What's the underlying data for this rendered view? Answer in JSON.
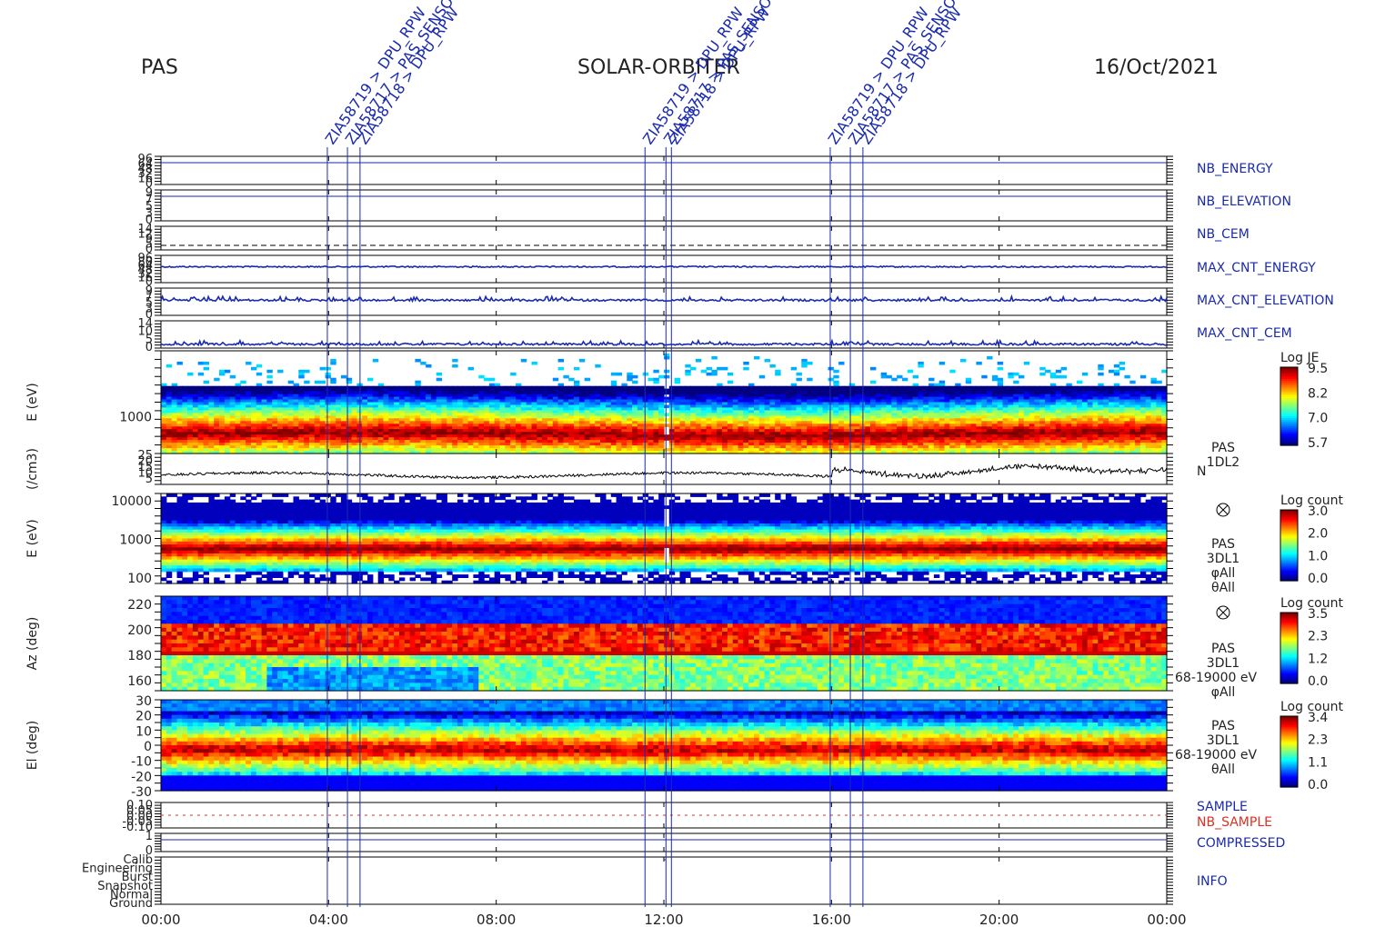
{
  "header": {
    "left": "PAS",
    "center": "SOLAR-ORBITER",
    "right": "16/Oct/2021"
  },
  "events": [
    {
      "hour": 3.97,
      "label": "ZIA58719 > DPU_RPW"
    },
    {
      "hour": 4.45,
      "label": "ZIA58717 > PAS_SENSOR"
    },
    {
      "hour": 4.75,
      "label": "ZIA58718 > DPU_RPW"
    },
    {
      "hour": 11.55,
      "label": "ZIA58719 > DPU_RPW"
    },
    {
      "hour": 12.05,
      "label": "ZIA58717 > PAS_SENSOR"
    },
    {
      "hour": 12.18,
      "label": "ZIA58718 > DPU_RPW"
    },
    {
      "hour": 15.97,
      "label": "ZIA58719 > DPU_RPW"
    },
    {
      "hour": 16.45,
      "label": "ZIA58717 > PAS_SENSOR"
    },
    {
      "hour": 16.75,
      "label": "ZIA58718 > DPU_RPW"
    }
  ],
  "chart_data": {
    "type": "heatmap",
    "x_ticks": [
      "00:00",
      "04:00",
      "08:00",
      "12:00",
      "16:00",
      "20:00",
      "00:00"
    ],
    "x_range_hours": [
      0,
      24
    ],
    "panels": [
      {
        "id": "nb-energy",
        "label": "NB_ENERGY",
        "label_color": "#1a2ab0",
        "kind": "hk",
        "ticks": [
          "96",
          "64",
          "48",
          "32",
          "16",
          "0"
        ]
      },
      {
        "id": "nb-elevation",
        "label": "NB_ELEVATION",
        "label_color": "#1a2ab0",
        "kind": "hk",
        "ticks": [
          "9",
          "7",
          "5",
          "3",
          "0"
        ]
      },
      {
        "id": "nb-cem",
        "label": "NB_CEM",
        "label_color": "#1a2ab0",
        "kind": "hk",
        "ticks": [
          "14",
          "12",
          "9",
          "5",
          "0"
        ]
      },
      {
        "id": "max-cnt-energy",
        "label": "MAX_CNT_ENERGY",
        "label_color": "#1a2ab0",
        "kind": "hk",
        "ticks": [
          "96",
          "80",
          "64",
          "48",
          "32",
          "16",
          "0"
        ],
        "typical_value": 56
      },
      {
        "id": "max-cnt-elevation",
        "label": "MAX_CNT_ELEVATION",
        "label_color": "#1a2ab0",
        "kind": "hk",
        "ticks": [
          "9",
          "7",
          "5",
          "3",
          "0"
        ],
        "typical_value": 5
      },
      {
        "id": "max-cnt-cem",
        "label": "MAX_CNT_CEM",
        "label_color": "#1a2ab0",
        "kind": "hk",
        "ticks": [
          "14",
          "10",
          "5",
          "0"
        ],
        "typical_value": 2
      },
      {
        "id": "spec-1dl2",
        "ylabel": "E (eV)",
        "kind": "spectrogram",
        "ticks": [
          "1000"
        ],
        "colorbar": {
          "title": "Log JE",
          "ticks": [
            "9.5",
            "8.2",
            "7.0",
            "5.7"
          ]
        }
      },
      {
        "id": "density",
        "ylabel": "(/cm3)",
        "kind": "line",
        "ticks": [
          "25",
          "20",
          "15",
          "10",
          "5"
        ],
        "label_lines": [
          "PAS",
          "1DL2"
        ],
        "label_suffix": "N",
        "y_range": [
          5,
          25
        ],
        "typical_value": 11
      },
      {
        "id": "spec-3dl1",
        "ylabel": "E (eV)",
        "kind": "spectrogram",
        "ticks": [
          "10000",
          "1000",
          "100"
        ],
        "label_lines": [
          "PAS",
          "3DL1",
          "φAll",
          "θAll"
        ],
        "colorbar": {
          "title": "Log count",
          "ticks": [
            "3.0",
            "2.0",
            "1.0",
            "0.0"
          ]
        }
      },
      {
        "id": "azimuth",
        "ylabel": "Az (deg)",
        "kind": "heatmap",
        "ticks": [
          "220",
          "200",
          "180",
          "160"
        ],
        "label_lines": [
          "PAS",
          "3DL1",
          "68-19000 eV",
          "φAll"
        ],
        "colorbar": {
          "title": "Log count",
          "ticks": [
            "3.5",
            "2.3",
            "1.2",
            "0.0"
          ]
        }
      },
      {
        "id": "elevation",
        "ylabel": "El (deg)",
        "kind": "heatmap",
        "ticks": [
          "30",
          "20",
          "10",
          "0",
          "-10",
          "-20",
          "-30"
        ],
        "label_lines": [
          "PAS",
          "3DL1",
          "68-19000 eV",
          "θAll"
        ],
        "colorbar": {
          "title": "Log count",
          "ticks": [
            "3.4",
            "2.3",
            "1.1",
            "0.0"
          ]
        }
      },
      {
        "id": "sample",
        "label": "SAMPLE",
        "label_color": "#1a2ab0",
        "label2": "NB_SAMPLE",
        "label2_color": "#e03020",
        "kind": "hk",
        "ticks": [
          "0.10",
          "0.05",
          "0.00",
          "-0.05",
          "-0.10"
        ]
      },
      {
        "id": "compressed",
        "label": "COMPRESSED",
        "label_color": "#1a2ab0",
        "kind": "hk",
        "ticks": [
          "1",
          "0"
        ]
      },
      {
        "id": "info",
        "label": "INFO",
        "label_color": "#1a2ab0",
        "kind": "hk",
        "ticks": [
          "Calib",
          "Engineering",
          "Burst",
          "Snapshot",
          "Normal",
          "Ground"
        ]
      }
    ]
  }
}
